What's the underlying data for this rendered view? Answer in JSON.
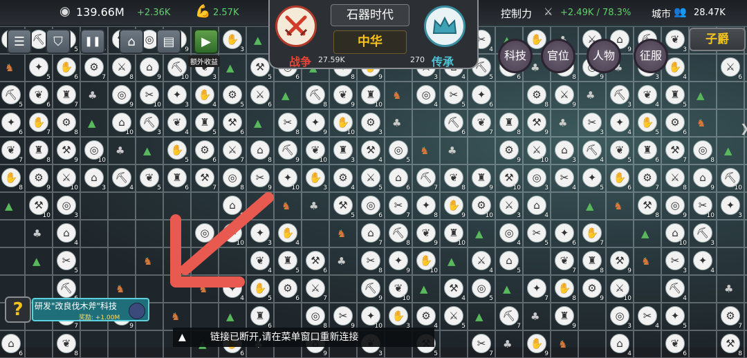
{
  "top_bar": {
    "gold": "139.66M",
    "gold_rate": "+2.36K",
    "strength": "2.57K",
    "control_label": "控制力",
    "control_value": "+2.49K / 78.3%",
    "city_label": "城市",
    "city_value": "28.47K"
  },
  "center": {
    "era": "石器时代",
    "civilization": "中华",
    "war_label": "战争",
    "war_value": "27.59K",
    "legacy_label": "传承",
    "legacy_value": "270"
  },
  "left_buttons": [
    {
      "name": "menu-button",
      "icon": "☰"
    },
    {
      "name": "banner-button",
      "icon": "⛉"
    },
    {
      "name": "pause-button",
      "icon": "❚❚"
    },
    {
      "name": "city-button",
      "icon": "⌂"
    },
    {
      "name": "book-button",
      "icon": "▤"
    }
  ],
  "bonus": {
    "label": "额外收益",
    "icon": "▶"
  },
  "right_buttons": [
    "科技",
    "官位",
    "人物",
    "征服"
  ],
  "rank": "子爵",
  "quest": {
    "mark": "?",
    "title": "研发\"改良伐木斧\"科技",
    "reward": "奖励: +1.00M"
  },
  "disconnect": {
    "caret": "▲",
    "message": "链接已断开,请在菜单窗口重新连接"
  },
  "colors": {
    "accent_gold": "#f4c31c",
    "gain_green": "#5fd16a",
    "war_red": "#d23a2a",
    "legacy_teal": "#3fa3b5",
    "arrow_red": "#e85a4f"
  }
}
